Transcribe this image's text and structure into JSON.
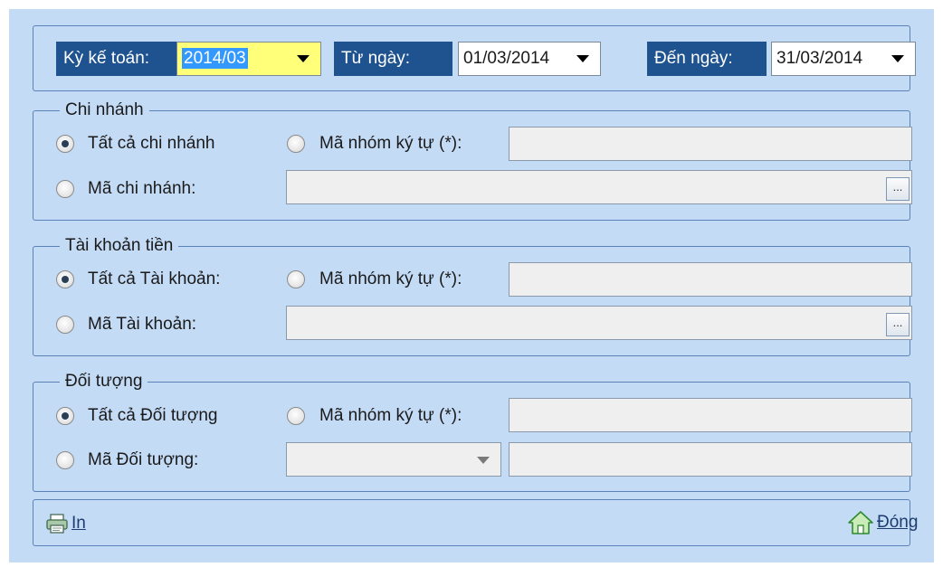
{
  "header": {
    "period_label": "Kỳ kế toán:",
    "period_value": "2014/03",
    "from_label": "Từ ngày:",
    "from_value": "01/03/2014",
    "to_label": "Đến ngày:",
    "to_value": "31/03/2014"
  },
  "branch": {
    "title": "Chi nhánh",
    "all_label": "Tất cả chi nhánh",
    "group_label": "Mã nhóm ký tự (*):",
    "code_label": "Mã chi nhánh:",
    "browse_label": "..."
  },
  "account": {
    "title": "Tài khoản tiền",
    "all_label": "Tất cả Tài khoản:",
    "group_label": "Mã nhóm ký tự (*):",
    "code_label": "Mã Tài khoản:",
    "browse_label": "..."
  },
  "object": {
    "title": "Đối tượng",
    "all_label": "Tất cả Đối tượng",
    "group_label": "Mã nhóm ký tự (*):",
    "code_label": "Mã Đối tượng:"
  },
  "footer": {
    "print_label": "In",
    "close_label": "Đóng"
  },
  "colors": {
    "panel_bg": "#c4dbf6",
    "label_bg": "#1f5390",
    "highlight": "#ffff7a"
  }
}
